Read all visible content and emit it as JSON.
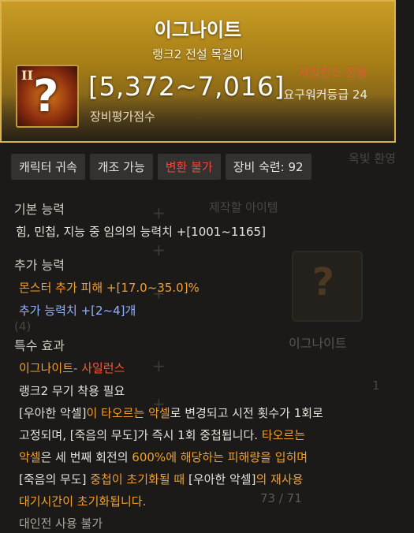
{
  "background": {
    "craft_title": "제작할 아이템",
    "craft_item_name": "이그나이트",
    "quantity": "1",
    "progress_text": "73 / 71",
    "tab_right": "옥빛 환영",
    "side_count": "(4)"
  },
  "header": {
    "item_name": "이그나이트",
    "item_type": "랭크2 전설 목걸이",
    "rank_badge": "II",
    "icon_glyph": "?",
    "score": "[5,372~7,016]",
    "score_label": "장비평가점수",
    "class_only": "사일런스 전용",
    "required_level": "요구워커등급 24"
  },
  "tags": {
    "bind": "캐릭터 귀속",
    "modify": "개조 가능",
    "convert": "변환 불가",
    "mastery": "장비 숙련: 92"
  },
  "basic": {
    "title": "기본 능력",
    "line": "힘, 민첩, 지능 중 임의의 능력치 +[1001~1165]"
  },
  "extra": {
    "title": "추가 능력",
    "monster_damage": "몬스터 추가 피해  +[17.0~35.0]%",
    "stat": "추가 능력치 +[2~4]개"
  },
  "special": {
    "title": "특수 효과",
    "skill_name": "이그나이트",
    "skill_sep": "- ",
    "skill_class": "사일런스",
    "req": "랭크2 무기 착용 필요",
    "l1_a": "[우아한 악셀]",
    "l1_b": "이 타오르는 악셀",
    "l1_c": "로 변경되고 시전 횟수가 1회로",
    "l2_a": "고정되며, ",
    "l2_b": "[죽음의 무도]",
    "l2_c": "가 즉시 1회 중첩됩니다. ",
    "l2_d": "타오르는",
    "l3_a": "악셀",
    "l3_b": "은 세 번째 회전",
    "l3_c": "의 ",
    "l3_d": "600%",
    "l3_e": "에 해당하는 피해량을 입히며",
    "l4_a": "[죽음의 무도]",
    "l4_b": " 중첩이 초기화될 때 ",
    "l4_c": "[우아한 악셀]",
    "l4_d": "의 재사용",
    "l5": "대기시간이 초기화됩니다.",
    "pvp": "대인전 사용 불가"
  }
}
